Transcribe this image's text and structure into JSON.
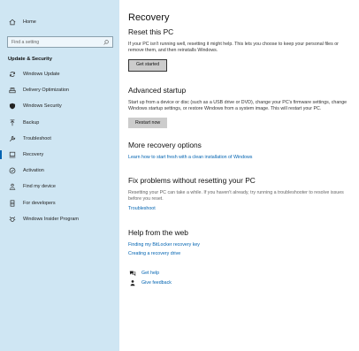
{
  "sidebar": {
    "home_label": "Home",
    "search_placeholder": "Find a setting",
    "section_title": "Update & Security",
    "items": [
      {
        "label": "Windows Update",
        "icon": "sync-icon"
      },
      {
        "label": "Delivery Optimization",
        "icon": "delivery-optimization-icon"
      },
      {
        "label": "Windows Security",
        "icon": "shield-icon"
      },
      {
        "label": "Backup",
        "icon": "backup-arrow-icon"
      },
      {
        "label": "Troubleshoot",
        "icon": "wrench-icon"
      },
      {
        "label": "Recovery",
        "icon": "recovery-icon",
        "active": true
      },
      {
        "label": "Activation",
        "icon": "check-circle-icon"
      },
      {
        "label": "Find my device",
        "icon": "person-location-icon"
      },
      {
        "label": "For developers",
        "icon": "developer-icon"
      },
      {
        "label": "Windows Insider Program",
        "icon": "insider-icon"
      }
    ]
  },
  "main": {
    "title": "Recovery",
    "reset": {
      "heading": "Reset this PC",
      "description": "If your PC isn't running well, resetting it might help. This lets you choose to keep your personal files or remove them, and then reinstalls Windows.",
      "button": "Get started"
    },
    "advanced": {
      "heading": "Advanced startup",
      "description": "Start up from a device or disc (such as a USB drive or DVD), change your PC's firmware settings, change Windows startup settings, or restore Windows from a system image. This will restart your PC.",
      "button": "Restart now"
    },
    "more": {
      "heading": "More recovery options",
      "link": "Learn how to start fresh with a clean installation of Windows"
    },
    "fix": {
      "heading": "Fix problems without resetting your PC",
      "description": "Resetting your PC can take a while. If you haven't already, try running a troubleshooter to resolve issues before you reset.",
      "link": "Troubleshoot"
    },
    "web": {
      "heading": "Help from the web",
      "links": [
        "Finding my BitLocker recovery key",
        "Creating a recovery drive"
      ]
    },
    "help": {
      "get_help": "Get help",
      "give_feedback": "Give feedback"
    }
  },
  "colors": {
    "sidebar_bg": "#cfe6f3",
    "accent": "#0063b1",
    "button_bg": "#cccccc"
  }
}
